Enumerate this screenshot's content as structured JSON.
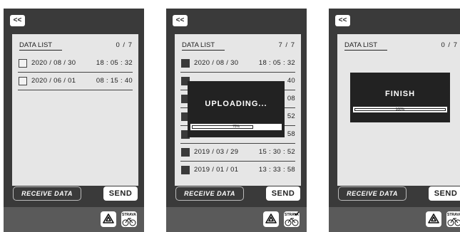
{
  "screens": [
    {
      "back_label": "<<",
      "list_title": "DATA LIST",
      "count": "0 / 7",
      "rows": [
        {
          "date": "2020 / 08 / 30",
          "time": "18 : 05 : 32",
          "checked": false
        },
        {
          "date": "2020 / 06 / 01",
          "time": "08 : 15 : 40",
          "checked": false
        }
      ],
      "receive_label": "RECEIVE DATA",
      "send_label": "SEND"
    },
    {
      "back_label": "<<",
      "list_title": "DATA LIST",
      "count": "7 / 7",
      "rows": [
        {
          "date": "2020 / 08 / 30",
          "time": "18 : 05 : 32",
          "checked": true
        },
        {
          "date": "",
          "time": "40",
          "checked": true
        },
        {
          "date": "",
          "time": "08",
          "checked": true
        },
        {
          "date": "",
          "time": "52",
          "checked": true
        },
        {
          "date": "",
          "time": "58",
          "checked": true
        },
        {
          "date": "2019 / 03 / 29",
          "time": "15 : 30 : 52",
          "checked": true
        },
        {
          "date": "2019 / 01 / 01",
          "time": "13 : 33 : 58",
          "checked": true
        }
      ],
      "receive_label": "RECEIVE DATA",
      "send_label": "SEND",
      "overlay": {
        "title": "UPLOADING...",
        "progress_text": "70%",
        "progress": 0.7
      }
    },
    {
      "back_label": "<<",
      "list_title": "DATA LIST",
      "count": "0 / 7",
      "rows": [],
      "receive_label": "RECEIVE DATA",
      "send_label": "SEND",
      "overlay": {
        "title": "FINISH",
        "progress_text": "100%",
        "progress": 1.0
      }
    }
  ],
  "apps": {
    "drive_icon": "google-drive-icon",
    "strava_icon": "strava-icon",
    "strava_text": "STRAVA"
  },
  "colors": {
    "device": "#3a3a3a",
    "panel": "#e6e6e6",
    "overlay": "#222222"
  }
}
